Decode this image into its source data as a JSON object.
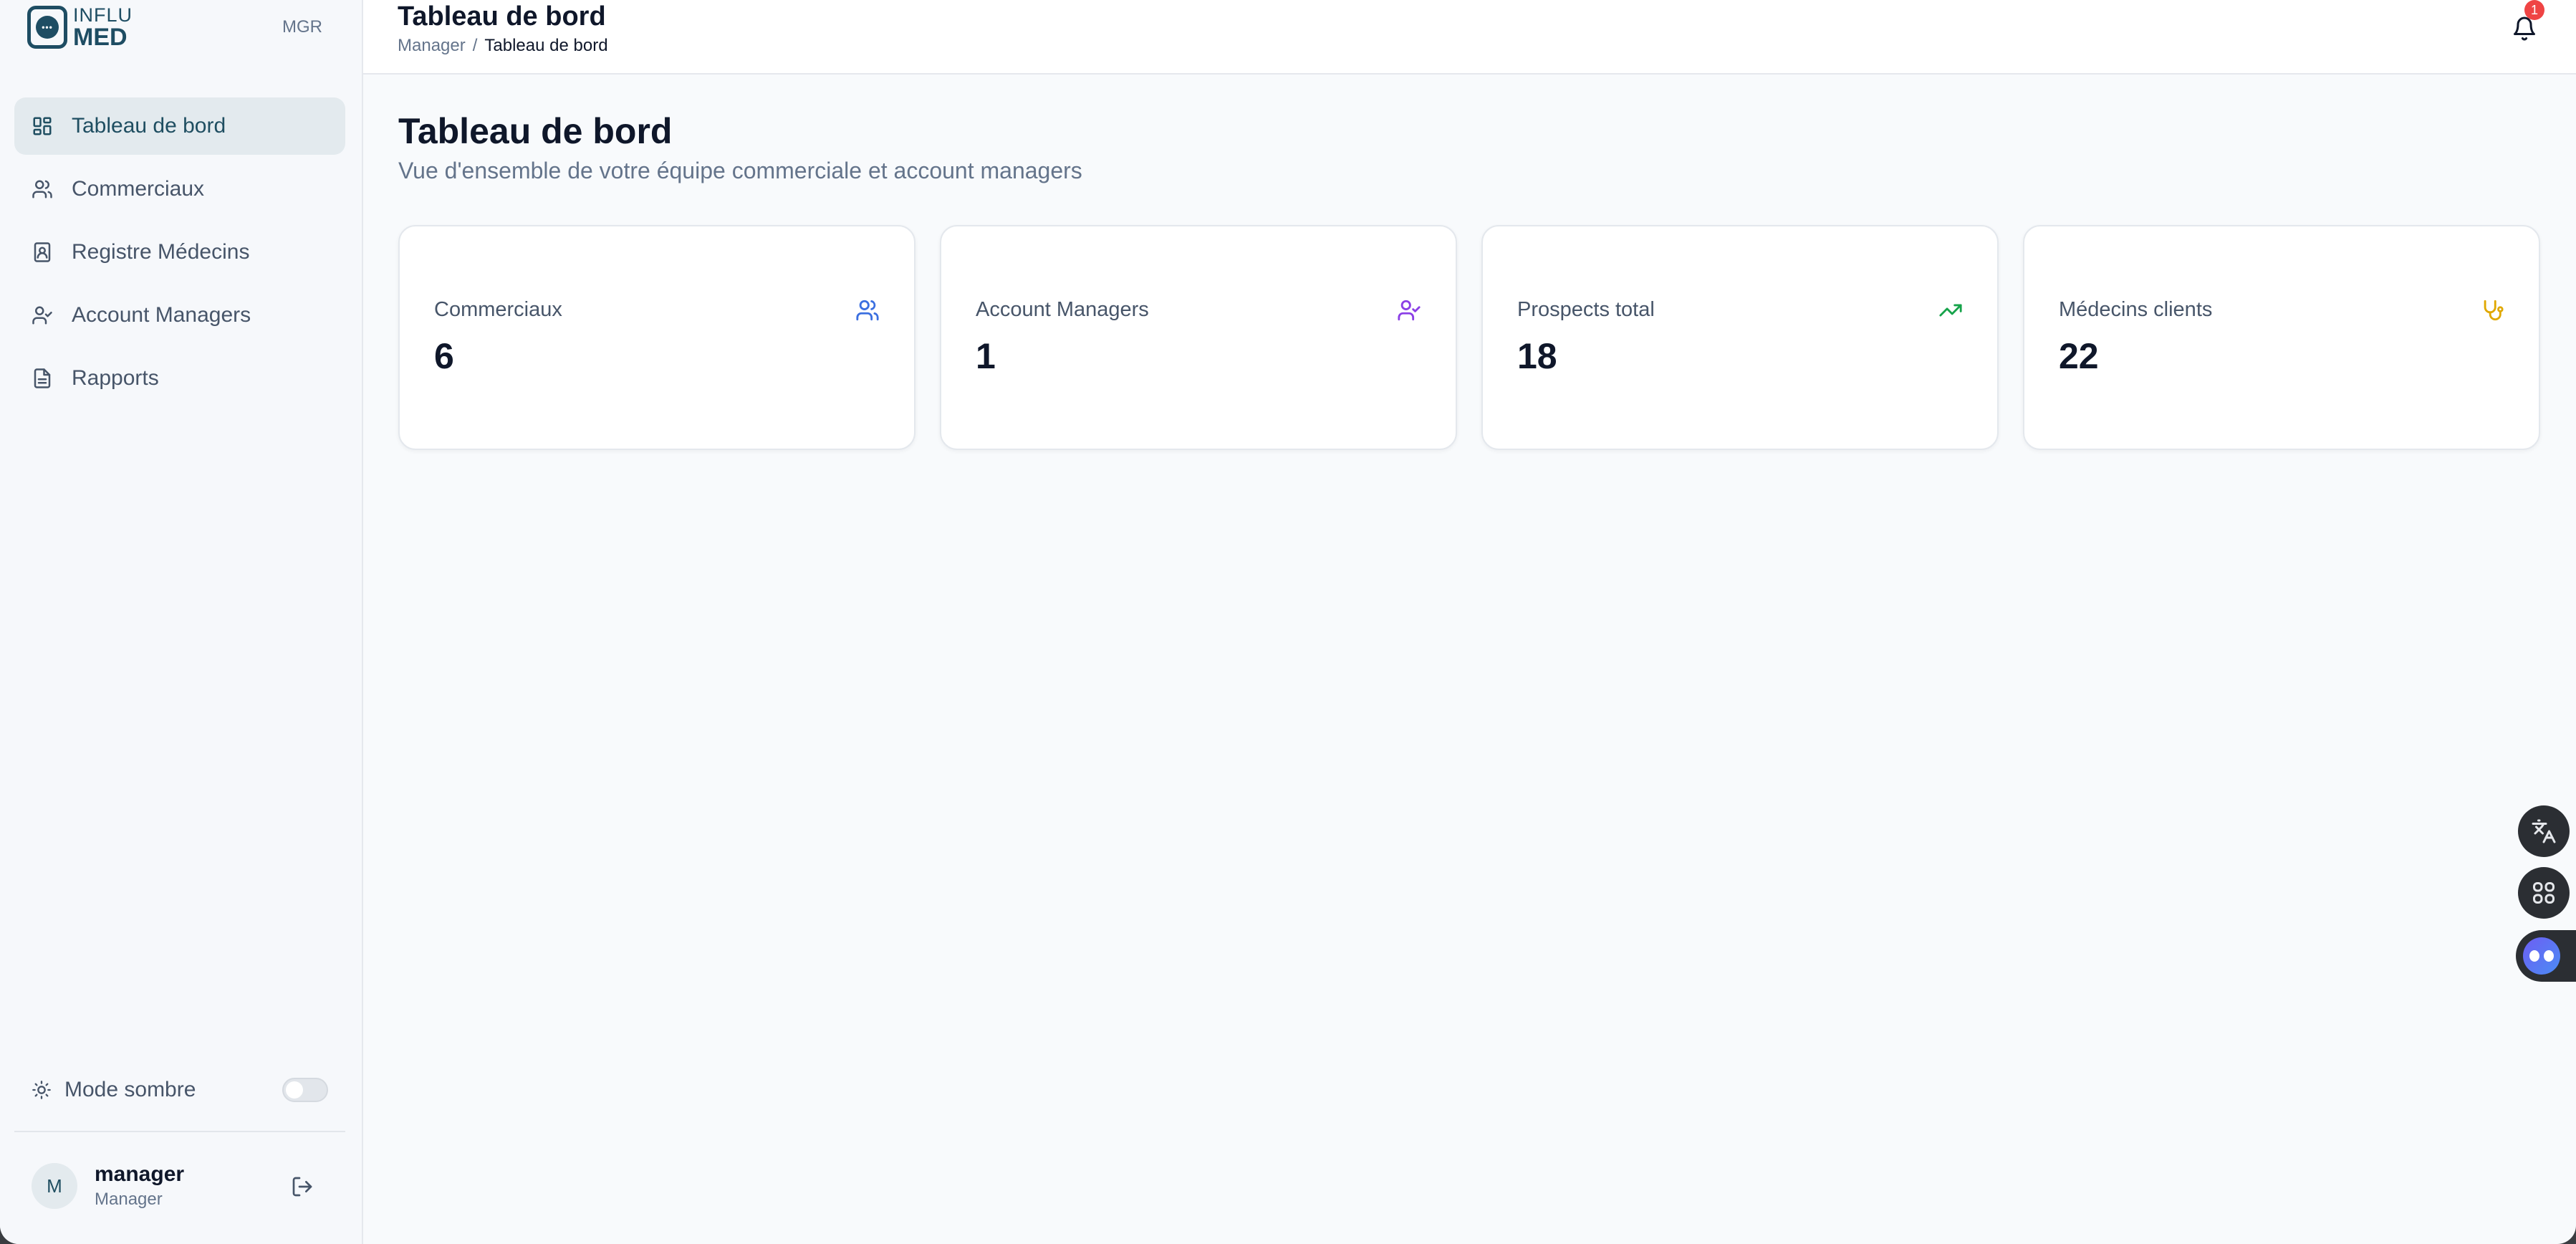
{
  "sidebar": {
    "logo": {
      "line1": "INFLU",
      "line2": "MED",
      "mark": "•••"
    },
    "role_tag": "MGR",
    "items": [
      {
        "label": "Tableau de bord",
        "icon": "dashboard-icon",
        "active": true
      },
      {
        "label": "Commerciaux",
        "icon": "users-icon",
        "active": false
      },
      {
        "label": "Registre Médecins",
        "icon": "contact-book-icon",
        "active": false
      },
      {
        "label": "Account Managers",
        "icon": "user-check-icon",
        "active": false
      },
      {
        "label": "Rapports",
        "icon": "file-text-icon",
        "active": false
      }
    ],
    "dark_mode_label": "Mode sombre",
    "user": {
      "initial": "M",
      "name": "manager",
      "role": "Manager"
    }
  },
  "header": {
    "title": "Tableau de bord",
    "breadcrumb": {
      "root": "Manager",
      "separator": "/",
      "current": "Tableau de bord"
    },
    "notification_count": "1"
  },
  "main": {
    "title": "Tableau de bord",
    "subtitle": "Vue d'ensemble de votre équipe commerciale et account managers",
    "cards": [
      {
        "label": "Commerciaux",
        "value": "6",
        "icon": "users-icon",
        "color": "#3b6fe0"
      },
      {
        "label": "Account Managers",
        "value": "1",
        "icon": "user-check-icon",
        "color": "#8b3fe6"
      },
      {
        "label": "Prospects total",
        "value": "18",
        "icon": "trending-up-icon",
        "color": "#16a34a"
      },
      {
        "label": "Médecins clients",
        "value": "22",
        "icon": "stethoscope-icon",
        "color": "#e0a800"
      }
    ]
  },
  "colors": {
    "accent": "#1f4e61",
    "badge": "#ef4444"
  }
}
